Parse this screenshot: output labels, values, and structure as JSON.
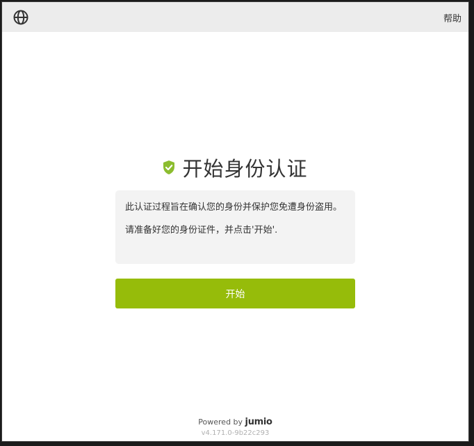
{
  "header": {
    "language_icon": "globe-icon",
    "help_label": "帮助"
  },
  "main": {
    "title_icon": "shield-check-icon",
    "title": "开始身份认证",
    "info_paragraph_1": "此认证过程旨在确认您的身份并保护您免遭身份盗用。",
    "info_paragraph_2": "请准备好您的身份证件，并点击'开始'.",
    "start_button_label": "开始"
  },
  "footer": {
    "powered_by": "Powered by",
    "brand": "jumio",
    "version": "v4.171.0-9b22c293"
  },
  "colors": {
    "accent": "#96bc0a",
    "shield": "#8cbd2f",
    "header_bg": "#ececec",
    "info_bg": "#f3f3f3"
  }
}
